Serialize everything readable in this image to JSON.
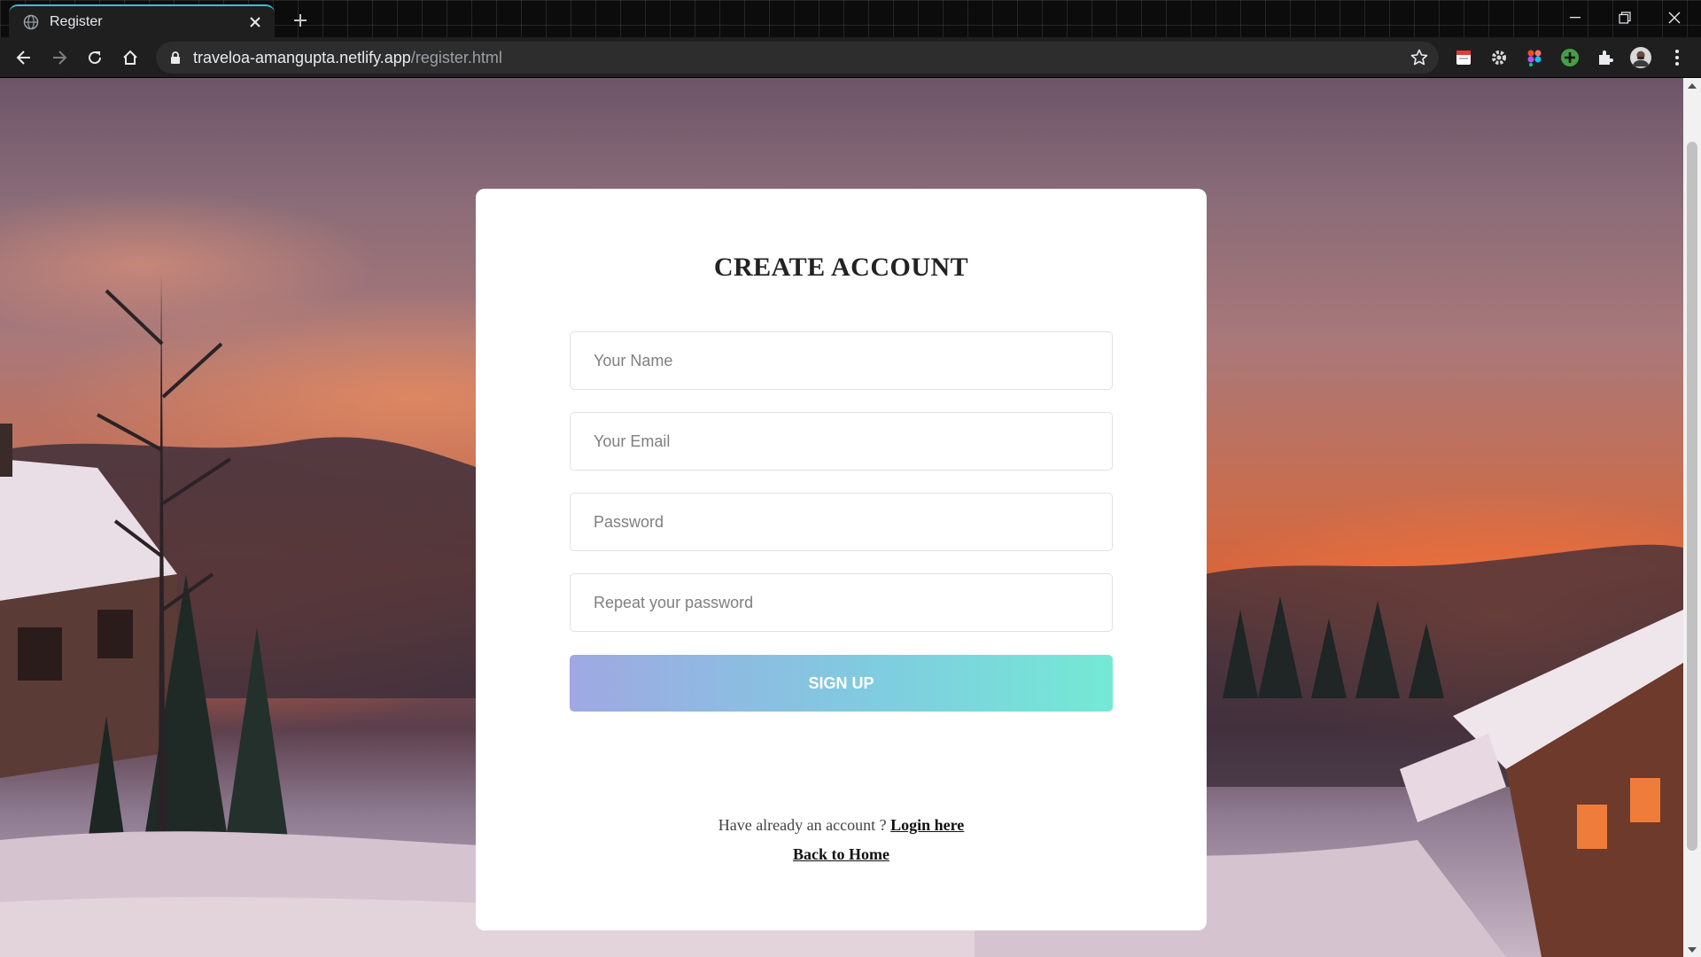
{
  "browser": {
    "tab_title": "Register",
    "url_host": "traveloa-amangupta.netlify.app",
    "url_path": "/register.html"
  },
  "page": {
    "title": "CREATE ACCOUNT",
    "fields": {
      "name_placeholder": "Your Name",
      "email_placeholder": "Your Email",
      "password_placeholder": "Password",
      "repeat_password_placeholder": "Repeat your password"
    },
    "signup_label": "SIGN UP",
    "have_account_text": "Have already an account ? ",
    "login_link": "Login here",
    "back_home_link": "Back to Home"
  },
  "colors": {
    "button_gradient_start": "#9fa8e3",
    "button_gradient_end": "#74e9d5",
    "tab_accent": "#39c2d6"
  }
}
